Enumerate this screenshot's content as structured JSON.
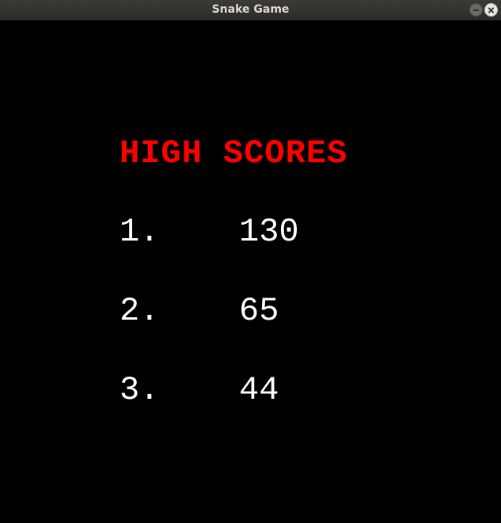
{
  "window": {
    "title": "Snake Game"
  },
  "colors": {
    "heading": "#ff0000",
    "text": "#ffffff",
    "background": "#000000"
  },
  "high_scores": {
    "heading": "HIGH SCORES",
    "entries": [
      {
        "rank": "1.",
        "score": "130"
      },
      {
        "rank": "2.",
        "score": "65"
      },
      {
        "rank": "3.",
        "score": "44"
      }
    ]
  }
}
